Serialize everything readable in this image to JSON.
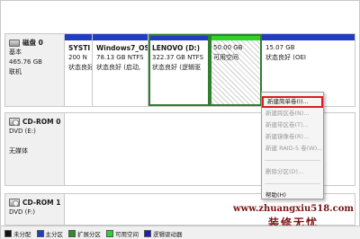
{
  "disk0": {
    "title": "磁盘 0",
    "type": "基本",
    "size": "465.76 GB",
    "status": "联机",
    "partitions": [
      {
        "name": "SYSTI",
        "line2": "200 N",
        "line3": "状态良好",
        "band": "#1f3fbf",
        "hatched": false
      },
      {
        "name": "Windows7_OS",
        "line2": "78.13 GB NTFS",
        "line3": "状态良好 (启动,",
        "band": "#1f3fbf",
        "hatched": false
      },
      {
        "name": "LENOVO  (D:)",
        "line2": "322.37 GB NTFS",
        "line3": "状态良好 (逻辑驱",
        "band": "#1f3fbf",
        "hatched": false,
        "selected": true
      },
      {
        "name": "",
        "line2": "50.00 GB",
        "line3": "可用空间",
        "band": "#2fd12f",
        "hatched": true,
        "selected": true
      },
      {
        "name": "",
        "line2": "15.07 GB",
        "line3": "状态良好 (OEI",
        "band": "#1f3fbf",
        "hatched": false
      }
    ]
  },
  "cdrom0": {
    "title": "CD-ROM 0",
    "drive": "DVD (E:)",
    "media": "无媒体"
  },
  "cdrom1": {
    "title": "CD-ROM 1",
    "drive": "DVD (F:)"
  },
  "context_menu": {
    "items": [
      {
        "label": "新建简单卷(I)...",
        "enabled": true,
        "highlighted": true
      },
      {
        "label": "新建跨区卷(N)...",
        "enabled": false
      },
      {
        "label": "新建带区卷(T)...",
        "enabled": false
      },
      {
        "label": "新建镜像卷(R)...",
        "enabled": false
      },
      {
        "label": "新建 RAID-5 卷(W)...",
        "enabled": false
      },
      {
        "label": "删除分区(D)...",
        "enabled": false
      },
      {
        "label": "帮助(H)",
        "enabled": true
      }
    ]
  },
  "legend": [
    {
      "label": "未分配",
      "color": "#111111"
    },
    {
      "label": "主分区",
      "color": "#1f3fbf"
    },
    {
      "label": "扩展分区",
      "color": "#2e8b2e"
    },
    {
      "label": "可用空间",
      "color": "#2fd12f"
    },
    {
      "label": "逻辑驱动器",
      "color": "#1f1fb8"
    }
  ],
  "watermark": {
    "url": "www.zhuangxiu518.com",
    "text": "装修无忧"
  }
}
